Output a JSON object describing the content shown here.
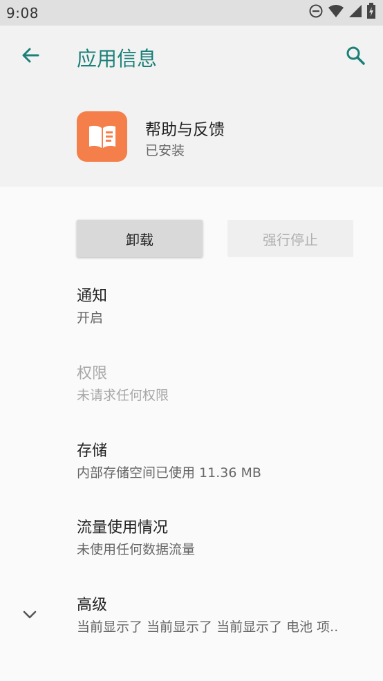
{
  "status_bar": {
    "time": "9:08",
    "icons": [
      "do-not-disturb-icon",
      "wifi-icon",
      "signal-icon",
      "battery-icon"
    ]
  },
  "toolbar": {
    "title": "应用信息",
    "back_icon": "back-arrow-icon",
    "search_icon": "search-icon"
  },
  "app": {
    "name": "帮助与反馈",
    "status": "已安装",
    "icon": "book-icon"
  },
  "buttons": {
    "uninstall": "卸载",
    "force_stop": "强行停止"
  },
  "items": [
    {
      "title": "通知",
      "subtitle": "开启",
      "enabled": true
    },
    {
      "title": "权限",
      "subtitle": "未请求任何权限",
      "enabled": false
    },
    {
      "title": "存储",
      "subtitle": "内部存储空间已使用 11.36 MB",
      "enabled": true
    },
    {
      "title": "流量使用情况",
      "subtitle": "未使用任何数据流量",
      "enabled": true
    },
    {
      "title": "高级",
      "subtitle": "当前显示了 当前显示了 当前显示了 电池 项..",
      "enabled": true
    }
  ],
  "colors": {
    "accent": "#1b8079",
    "app_icon_bg": "#f57f4a"
  }
}
